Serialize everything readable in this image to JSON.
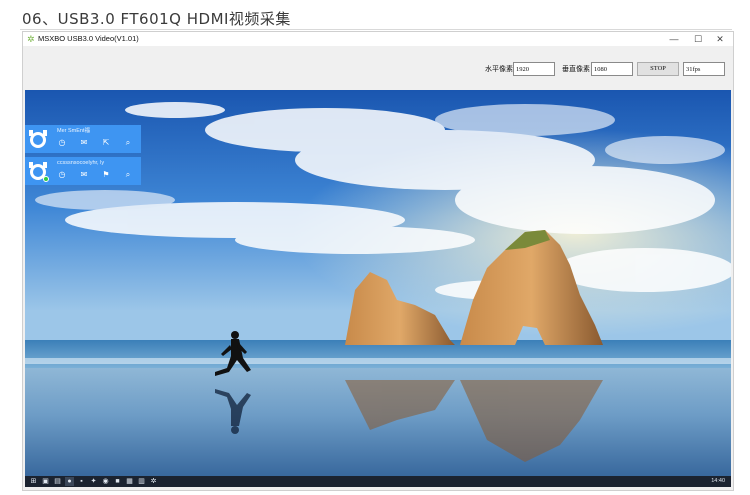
{
  "page": {
    "heading": "06、USB3.0 FT601Q HDMI视频采集"
  },
  "window": {
    "title": "MSXBO USB3.0 Video(V1.01)",
    "icon": "app-flower-icon",
    "controls": {
      "minimize": "—",
      "maximize": "☐",
      "close": "✕"
    }
  },
  "toolbar": {
    "h_label": "水平像素",
    "h_value": "1920",
    "v_label": "垂直像素",
    "v_value": "1080",
    "stop_label": "STOP",
    "fps_value": "31fps"
  },
  "overlay_panels": [
    {
      "name": "Mer SmEnt福",
      "icons": [
        "timer-icon",
        "mail-icon",
        "share-icon",
        "search-icon"
      ],
      "online": false
    },
    {
      "name": "ccsssnsocoelyhr, ly",
      "icons": [
        "timer-icon",
        "mail-icon",
        "flag-icon",
        "search-icon"
      ],
      "online": true
    }
  ],
  "taskbar": {
    "items": [
      "start-icon",
      "taskview-icon",
      "explorer-icon",
      "app-icon",
      "terminal-icon",
      "settings-icon",
      "browser-icon",
      "chat-icon",
      "store-icon",
      "notes-icon",
      "video-app-icon"
    ],
    "active_index": 3,
    "clock": "14:40"
  },
  "colors": {
    "panel": "#3e95f2",
    "taskbar": "#1b2330",
    "window_bg": "#f0f0f0"
  }
}
